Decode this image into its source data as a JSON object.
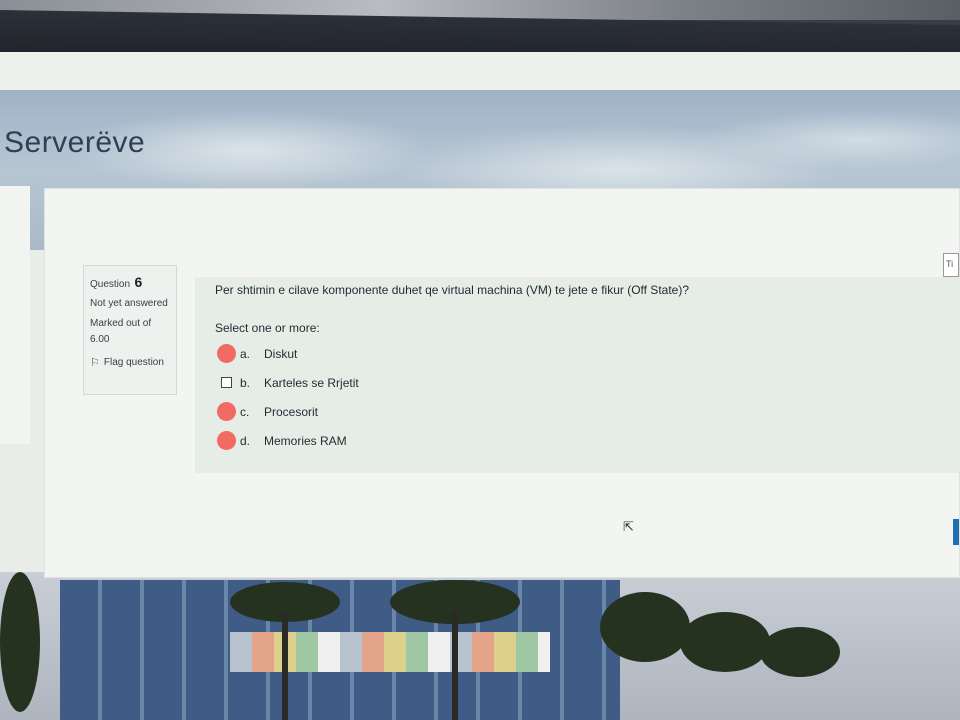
{
  "course": {
    "title": "Serverëve"
  },
  "question": {
    "label": "Question",
    "number": "6",
    "status": "Not yet answered",
    "marked_out_of": "Marked out of 6.00",
    "flag_label": "Flag question",
    "text": "Per shtimin e cilave komponente duhet qe virtual machina (VM) te jete e fikur (Off State)?",
    "prompt": "Select one or more:",
    "answers": [
      {
        "letter": "a.",
        "label": "Diskut",
        "marked": true
      },
      {
        "letter": "b.",
        "label": "Karteles se Rrjetit",
        "marked": false
      },
      {
        "letter": "c.",
        "label": "Procesorit",
        "marked": true
      },
      {
        "letter": "d.",
        "label": "Memories RAM",
        "marked": true
      }
    ]
  },
  "edge": {
    "button_text": "Ti"
  },
  "colors": {
    "mark": "#f26b63",
    "accent": "#1f6fb6"
  }
}
